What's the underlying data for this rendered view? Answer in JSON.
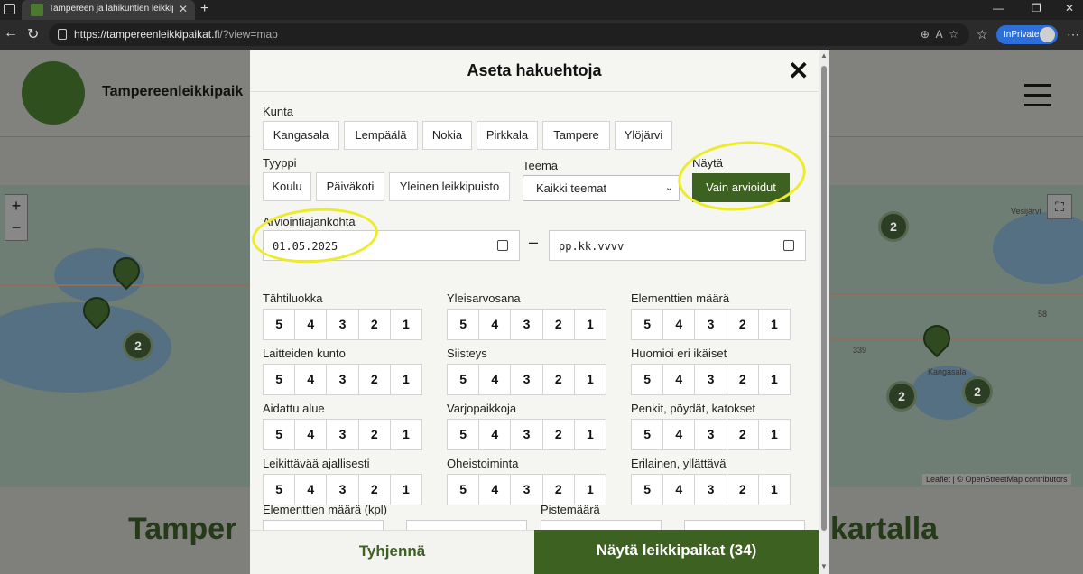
{
  "browser": {
    "tab_title": "Tampereen ja lähikuntien leikkipu",
    "url_main": "https://tampereenleikkipaikat.fi",
    "url_rest": "/?view=map",
    "inprivate": "InPrivate"
  },
  "site": {
    "title": "Tampereenleikkipaik",
    "heading_left": "Tamper",
    "heading_right": "kartalla"
  },
  "map": {
    "clusters": [
      "2",
      "2",
      "2",
      "2"
    ],
    "attribution": "Leaflet | © OpenStreetMap contributors",
    "labels": [
      "339",
      "58",
      "Kangasala",
      "Vesijärvi"
    ]
  },
  "modal": {
    "title": "Aseta hakuehtoja",
    "kunta_label": "Kunta",
    "kunta": [
      "Kangasala",
      "Lempäälä",
      "Nokia",
      "Pirkkala",
      "Tampere",
      "Ylöjärvi"
    ],
    "tyyppi_label": "Tyyppi",
    "tyyppi": [
      "Koulu",
      "Päiväkoti",
      "Yleinen leikkipuisto"
    ],
    "teema_label": "Teema",
    "teema_value": "Kaikki teemat",
    "nayta_label": "Näytä",
    "only_rated": "Vain arvioidut",
    "date_label": "Arviointiajankohta",
    "date_from": "01.05.2025",
    "date_to": "pp.kk.vvvv",
    "date_sep": "–",
    "rating_values": [
      "5",
      "4",
      "3",
      "2",
      "1"
    ],
    "ratings": [
      "Tähtiluokka",
      "Yleisarvosana",
      "Elementtien määrä",
      "Laitteiden kunto",
      "Siisteys",
      "Huomioi eri ikäiset",
      "Aidattu alue",
      "Varjopaikkoja",
      "Penkit, pöydät, katokset",
      "Leikittävää ajallisesti",
      "Oheistoiminta",
      "Erilainen, yllättävä"
    ],
    "elem_count_label": "Elementtien määrä (kpl)",
    "points_label": "Pistemäärä",
    "clear_button": "Tyhjennä",
    "show_button": "Näytä leikkipaikat (34)"
  }
}
